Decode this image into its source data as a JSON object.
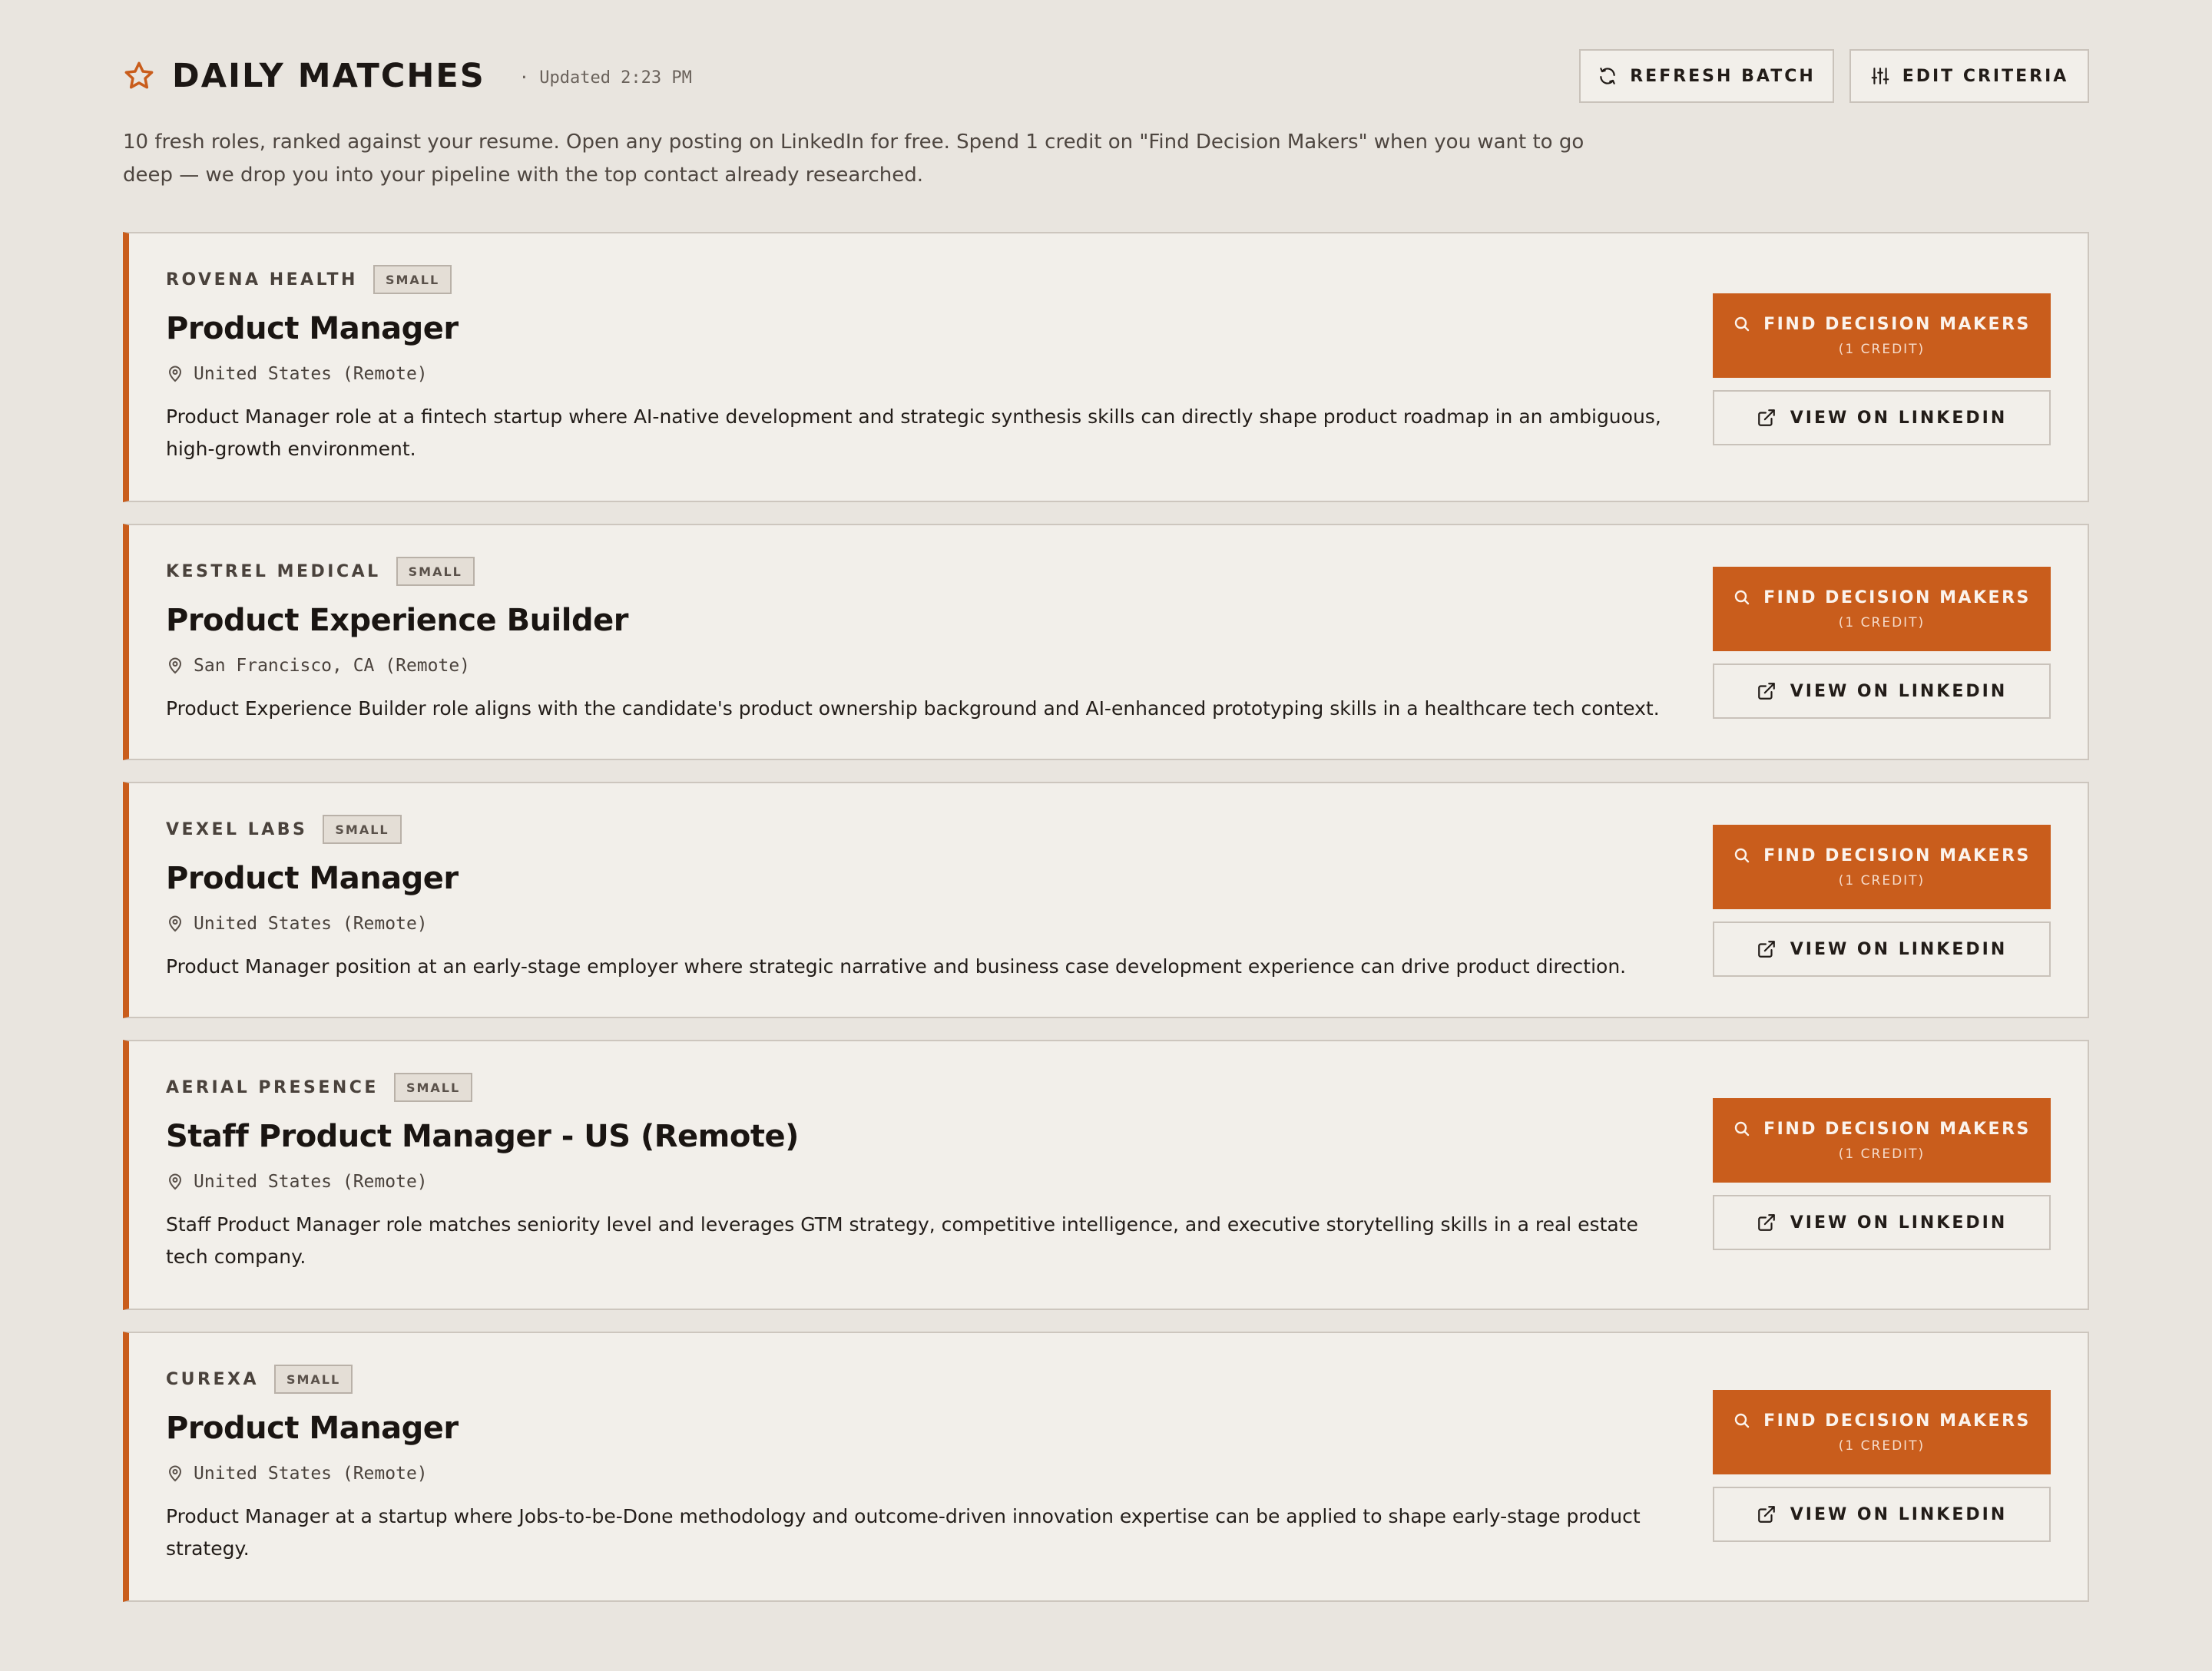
{
  "header": {
    "title": "DAILY MATCHES",
    "updated": "· Updated 2:23 PM",
    "refresh_label": "REFRESH BATCH",
    "edit_label": "EDIT CRITERIA",
    "subtitle": "10 fresh roles, ranked against your resume. Open any posting on LinkedIn for free. Spend 1 credit on \"Find Decision Makers\" when you want to go deep — we drop you into your pipeline with the top contact already researched."
  },
  "colors": {
    "accent": "#c95d1c",
    "background": "#e9e5df",
    "card": "#f2efea"
  },
  "actions": {
    "find_label": "FIND DECISION MAKERS",
    "find_cost": "(1 CREDIT)",
    "linkedin_label": "VIEW ON LINKEDIN"
  },
  "jobs": [
    {
      "company": "ROVENA HEALTH",
      "size": "SMALL",
      "title": "Product Manager",
      "location": "United States (Remote)",
      "description": "Product Manager role at a fintech startup where AI-native development and strategic synthesis skills can directly shape product roadmap in an ambiguous, high-growth environment."
    },
    {
      "company": "KESTREL MEDICAL",
      "size": "SMALL",
      "title": "Product Experience Builder",
      "location": "San Francisco, CA (Remote)",
      "description": "Product Experience Builder role aligns with the candidate's product ownership background and AI-enhanced prototyping skills in a healthcare tech context."
    },
    {
      "company": "VEXEL LABS",
      "size": "SMALL",
      "title": "Product Manager",
      "location": "United States (Remote)",
      "description": "Product Manager position at an early-stage employer where strategic narrative and business case development experience can drive product direction."
    },
    {
      "company": "AERIAL PRESENCE",
      "size": "SMALL",
      "title": "Staff Product Manager - US (Remote)",
      "location": "United States (Remote)",
      "description": "Staff Product Manager role matches seniority level and leverages GTM strategy, competitive intelligence, and executive storytelling skills in a real estate tech company."
    },
    {
      "company": "CUREXA",
      "size": "SMALL",
      "title": "Product Manager",
      "location": "United States (Remote)",
      "description": "Product Manager at a startup where Jobs-to-be-Done methodology and outcome-driven innovation expertise can be applied to shape early-stage product strategy."
    }
  ]
}
